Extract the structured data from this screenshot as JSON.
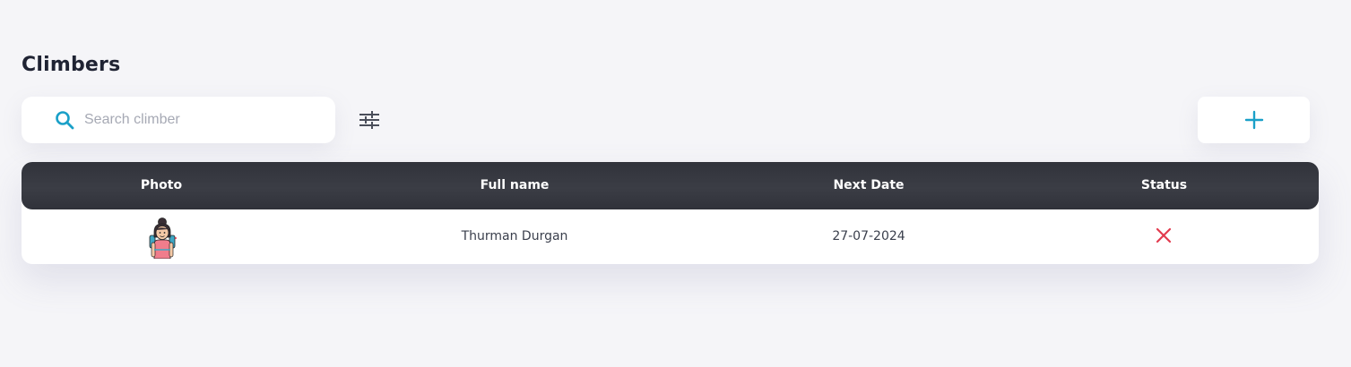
{
  "page": {
    "title": "Climbers"
  },
  "search": {
    "placeholder": "Search climber",
    "value": ""
  },
  "icons": {
    "search": "search-icon",
    "filter": "sliders-icon",
    "add": "plus-icon",
    "status_inactive": "close-icon"
  },
  "colors": {
    "accent": "#1aa0c8",
    "header_bg": "#35373f",
    "status_red": "#e23b4e",
    "background": "#f5f5f8"
  },
  "table": {
    "columns": [
      "Photo",
      "Full name",
      "Next Date",
      "Status"
    ],
    "rows": [
      {
        "photo": "climber-avatar",
        "full_name": "Thurman Durgan",
        "next_date": "27-07-2024",
        "status": "inactive"
      }
    ]
  }
}
